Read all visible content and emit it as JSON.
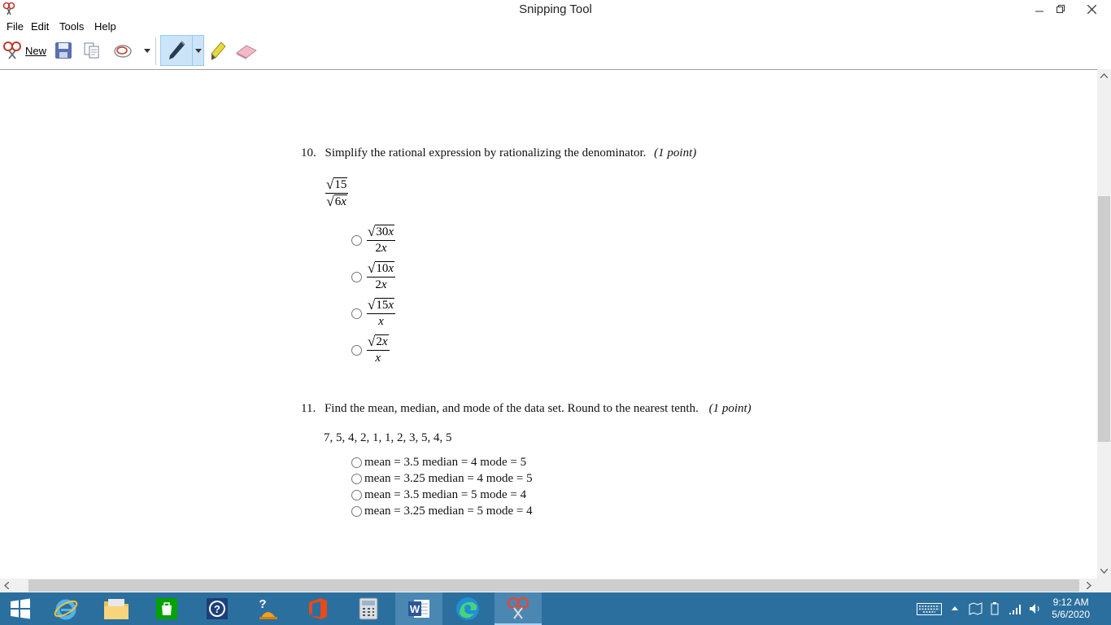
{
  "window": {
    "title": "Snipping Tool"
  },
  "menu": [
    "File",
    "Edit",
    "Tools",
    "Help"
  ],
  "toolbar": {
    "new_label": "New"
  },
  "q10": {
    "number": "10.",
    "text": "Simplify the rational expression by rationalizing the denominator.",
    "points": "(1 point)",
    "expr": {
      "num": "15",
      "den_coef": "6",
      "den_var": "x"
    },
    "options": [
      {
        "num_coef": "30",
        "num_var": "x",
        "den_coef": "2",
        "den_var": "x"
      },
      {
        "num_coef": "10",
        "num_var": "x",
        "den_coef": "2",
        "den_var": "x"
      },
      {
        "num_coef": "15",
        "num_var": "x",
        "den_coef": "",
        "den_var": "x"
      },
      {
        "num_coef": "2",
        "num_var": "x",
        "den_coef": "",
        "den_var": "x"
      }
    ]
  },
  "q11": {
    "number": "11.",
    "text": "Find the mean, median, and mode of the data set. Round to the nearest tenth.",
    "points": "(1 point)",
    "data": "7, 5, 4, 2, 1, 1, 2, 3, 5, 4, 5",
    "options": [
      "mean = 3.5 median = 4 mode = 5",
      "mean = 3.25 median = 4 mode = 5",
      "mean = 3.5 median = 5 mode = 4",
      "mean = 3.25 median = 5 mode = 4"
    ]
  },
  "taskbar": {
    "apps": [
      "start-icon",
      "internet-explorer-icon",
      "file-explorer-icon",
      "store-icon",
      "help-icon",
      "get-help-icon",
      "office-icon",
      "calculator-icon",
      "word-icon",
      "edge-icon",
      "snipping-tool-icon"
    ],
    "time": "9:12 AM",
    "date": "5/6/2020"
  },
  "colors": {
    "taskbar": "#2b6f9e",
    "pen_active": "#cce4f7"
  }
}
